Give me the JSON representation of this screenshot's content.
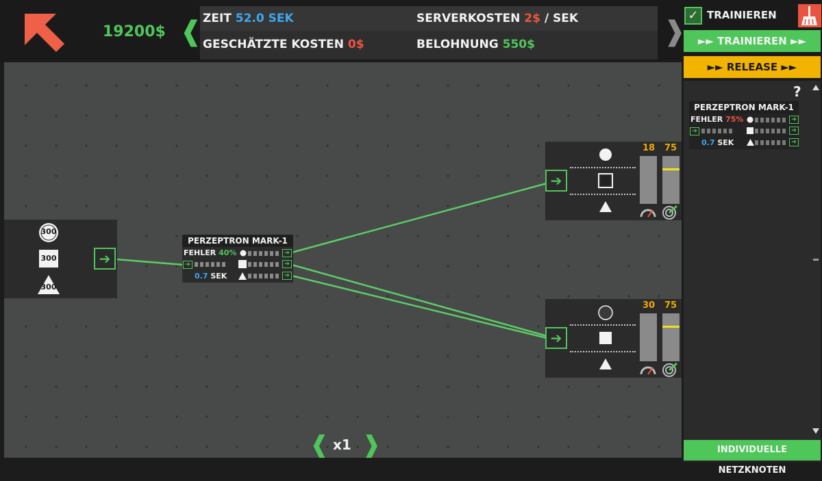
{
  "header": {
    "money": "19200$",
    "nav_left": "❰",
    "nav_right": "❱",
    "stats": {
      "time_label": "ZEIT",
      "time_value": "52.0 SEK",
      "server_label": "SERVERKOSTEN",
      "server_value": "2$",
      "server_unit": "/ SEK",
      "cost_label": "GESCHÄTZTE KOSTEN",
      "cost_value": "0$",
      "reward_label": "BELOHNUNG",
      "reward_value": "550$"
    }
  },
  "controls": {
    "train_checkbox_label": "TRAINIEREN",
    "train_checked": "✓",
    "train_button": "►► TRAINIEREN ►►",
    "release_button": "►► RELEASE ►►",
    "help": "?",
    "custom_nodes_button": "INDIVIDUELLE NETZKNOTEN"
  },
  "input_node": {
    "values": [
      "300",
      "300",
      "300"
    ],
    "port": "➔"
  },
  "perceptron": {
    "title": "PERZEPTRON MARK-1",
    "error_label": "FEHLER",
    "error_value": "40%",
    "time_value": "0.7",
    "time_unit": "SEK",
    "port": "➔"
  },
  "output_nodes": [
    {
      "count": "18",
      "target": "75",
      "count_fraction": 0.0,
      "target_fraction": 0.75,
      "port": "➔"
    },
    {
      "count": "30",
      "target": "75",
      "count_fraction": 0.0,
      "target_fraction": 0.75,
      "port": "➔"
    }
  ],
  "sidebar_card": {
    "title": "PERZEPTRON MARK-1",
    "error_label": "FEHLER",
    "error_value": "75%",
    "time_value": "0.7",
    "time_unit": "SEK",
    "port": "➔"
  },
  "speed": {
    "label": "x1",
    "left": "❰",
    "right": "❱"
  },
  "colors": {
    "accent_green": "#4fc65a",
    "warning_orange": "#f2a900",
    "error_red": "#ef5540",
    "info_blue": "#3da8ef",
    "release_yellow": "#f2b400"
  }
}
